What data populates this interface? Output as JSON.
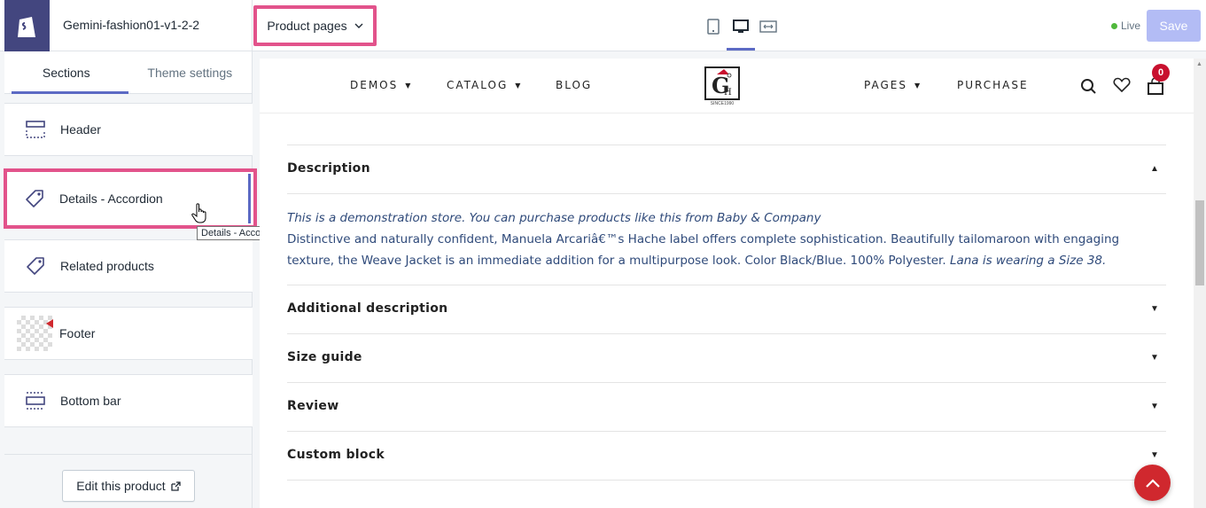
{
  "topbar": {
    "theme_name": "Gemini-fashion01-v1-2-2",
    "page_select": "Product pages",
    "live_label": "Live",
    "save_label": "Save"
  },
  "sidebar": {
    "tabs": [
      {
        "label": "Sections",
        "active": true
      },
      {
        "label": "Theme settings",
        "active": false
      }
    ],
    "items": [
      {
        "label": "Header",
        "icon": "header-layout-icon"
      },
      {
        "label": "Details - Accordion",
        "icon": "tag-icon"
      },
      {
        "label": "Related products",
        "icon": "tag-icon"
      },
      {
        "label": "Footer",
        "icon": "image-placeholder-icon"
      },
      {
        "label": "Bottom bar",
        "icon": "bottom-bar-layout-icon"
      }
    ],
    "tooltip": "Details - Accordion",
    "edit_button": "Edit this product"
  },
  "store": {
    "nav_left": [
      "DEMOS",
      "CATALOG",
      "BLOG"
    ],
    "nav_right": [
      "PAGES",
      "PURCHASE"
    ],
    "cart_count": "0",
    "logo_tagline": "SINCE1990"
  },
  "accordion": {
    "sections": [
      {
        "title": "Description",
        "open": true
      },
      {
        "title": "Additional description",
        "open": false
      },
      {
        "title": "Size guide",
        "open": false
      },
      {
        "title": "Review",
        "open": false
      },
      {
        "title": "Custom block",
        "open": false
      }
    ],
    "description_italic": "This is a demonstration store. You can purchase products like this from Baby & Company",
    "description_body": "Distinctive and naturally confident, Manuela Arcariâ€™s Hache label offers complete sophistication. Beautifully tailomaroon with engaging texture, the Weave Jacket is an immediate addition for a multipurpose look. Color Black/Blue. 100% Polyester.",
    "description_tail": "Lana is wearing a Size 38."
  },
  "colors": {
    "highlight": "#e2538b",
    "accent": "#5c6ac4",
    "shopify_logo_bg": "#43467f",
    "cart_badge": "#c8102e",
    "scroll_top": "#d0282e"
  }
}
